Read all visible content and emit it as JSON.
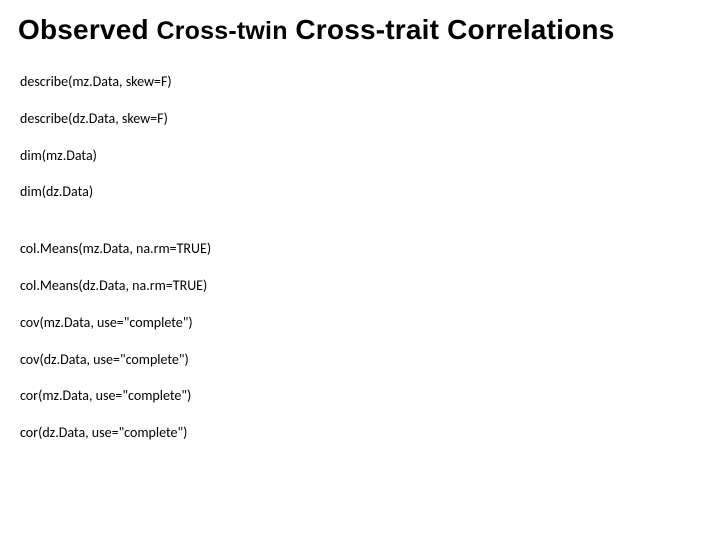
{
  "title": {
    "seg1": "Observed",
    "seg2": "Cross-twin",
    "seg3": "Cross-trait Correlations"
  },
  "lines": {
    "l0": "describe(mz.Data, skew=F)",
    "l1": "describe(dz.Data, skew=F)",
    "l2": "dim(mz.Data)",
    "l3": "dim(dz.Data)",
    "l4": "col.Means(mz.Data, na.rm=TRUE)",
    "l5": "col.Means(dz.Data, na.rm=TRUE)",
    "l6": "cov(mz.Data, use=\"complete\")",
    "l7": "cov(dz.Data, use=\"complete\")",
    "l8": "cor(mz.Data, use=\"complete\")",
    "l9": "cor(dz.Data, use=\"complete\")"
  }
}
